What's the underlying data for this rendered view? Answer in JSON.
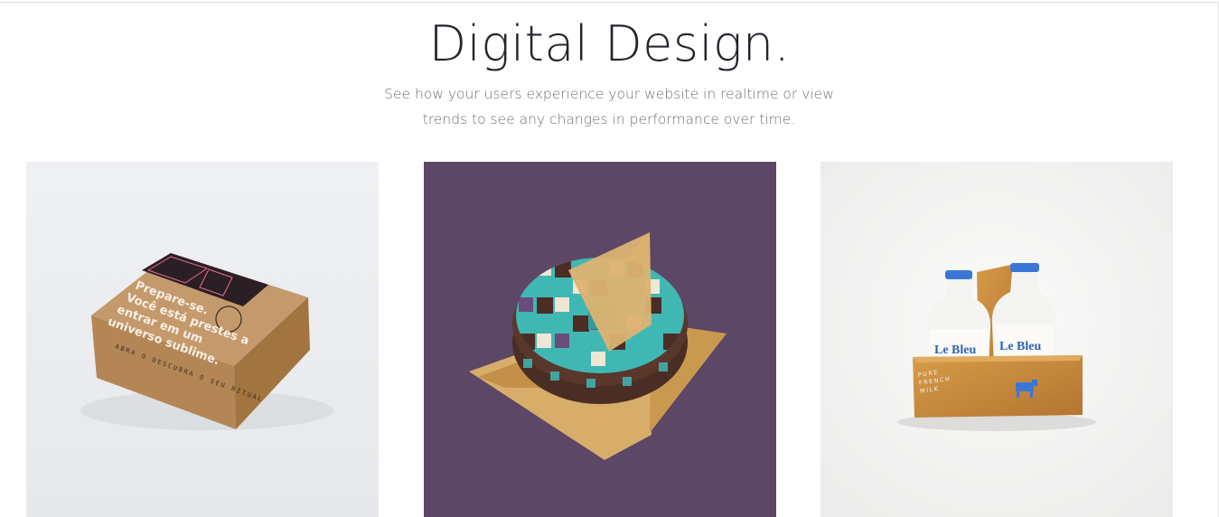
{
  "header": {
    "title": "Digital Design.",
    "subtitle_line1": "See how your users experience your website in realtime or view",
    "subtitle_line2": "trends to see any changes in performance over time."
  },
  "cards": [
    {
      "name": "kraft-box",
      "box_text": [
        "Prepare-se.",
        "Você está prestes a",
        "entrar em um",
        "universo sublime."
      ],
      "side_text": "ABRA O DESCUBRA O SEU RITUAL",
      "colors": {
        "background": "#eceef1",
        "kraft": "#c49a6c"
      }
    },
    {
      "name": "round-pattern-box",
      "colors": {
        "background": "#5d4766",
        "teal": "#3fb8b4",
        "brown": "#4a2e25",
        "cardboard": "#d8ad6a"
      }
    },
    {
      "name": "milk-bottles",
      "brand": "Le Bleu",
      "crate_text": [
        "PURE",
        "FRENCH",
        "MILK"
      ],
      "colors": {
        "background": "#f2f2f1",
        "cap": "#3a78d8",
        "wood": "#c98a3a"
      }
    }
  ]
}
